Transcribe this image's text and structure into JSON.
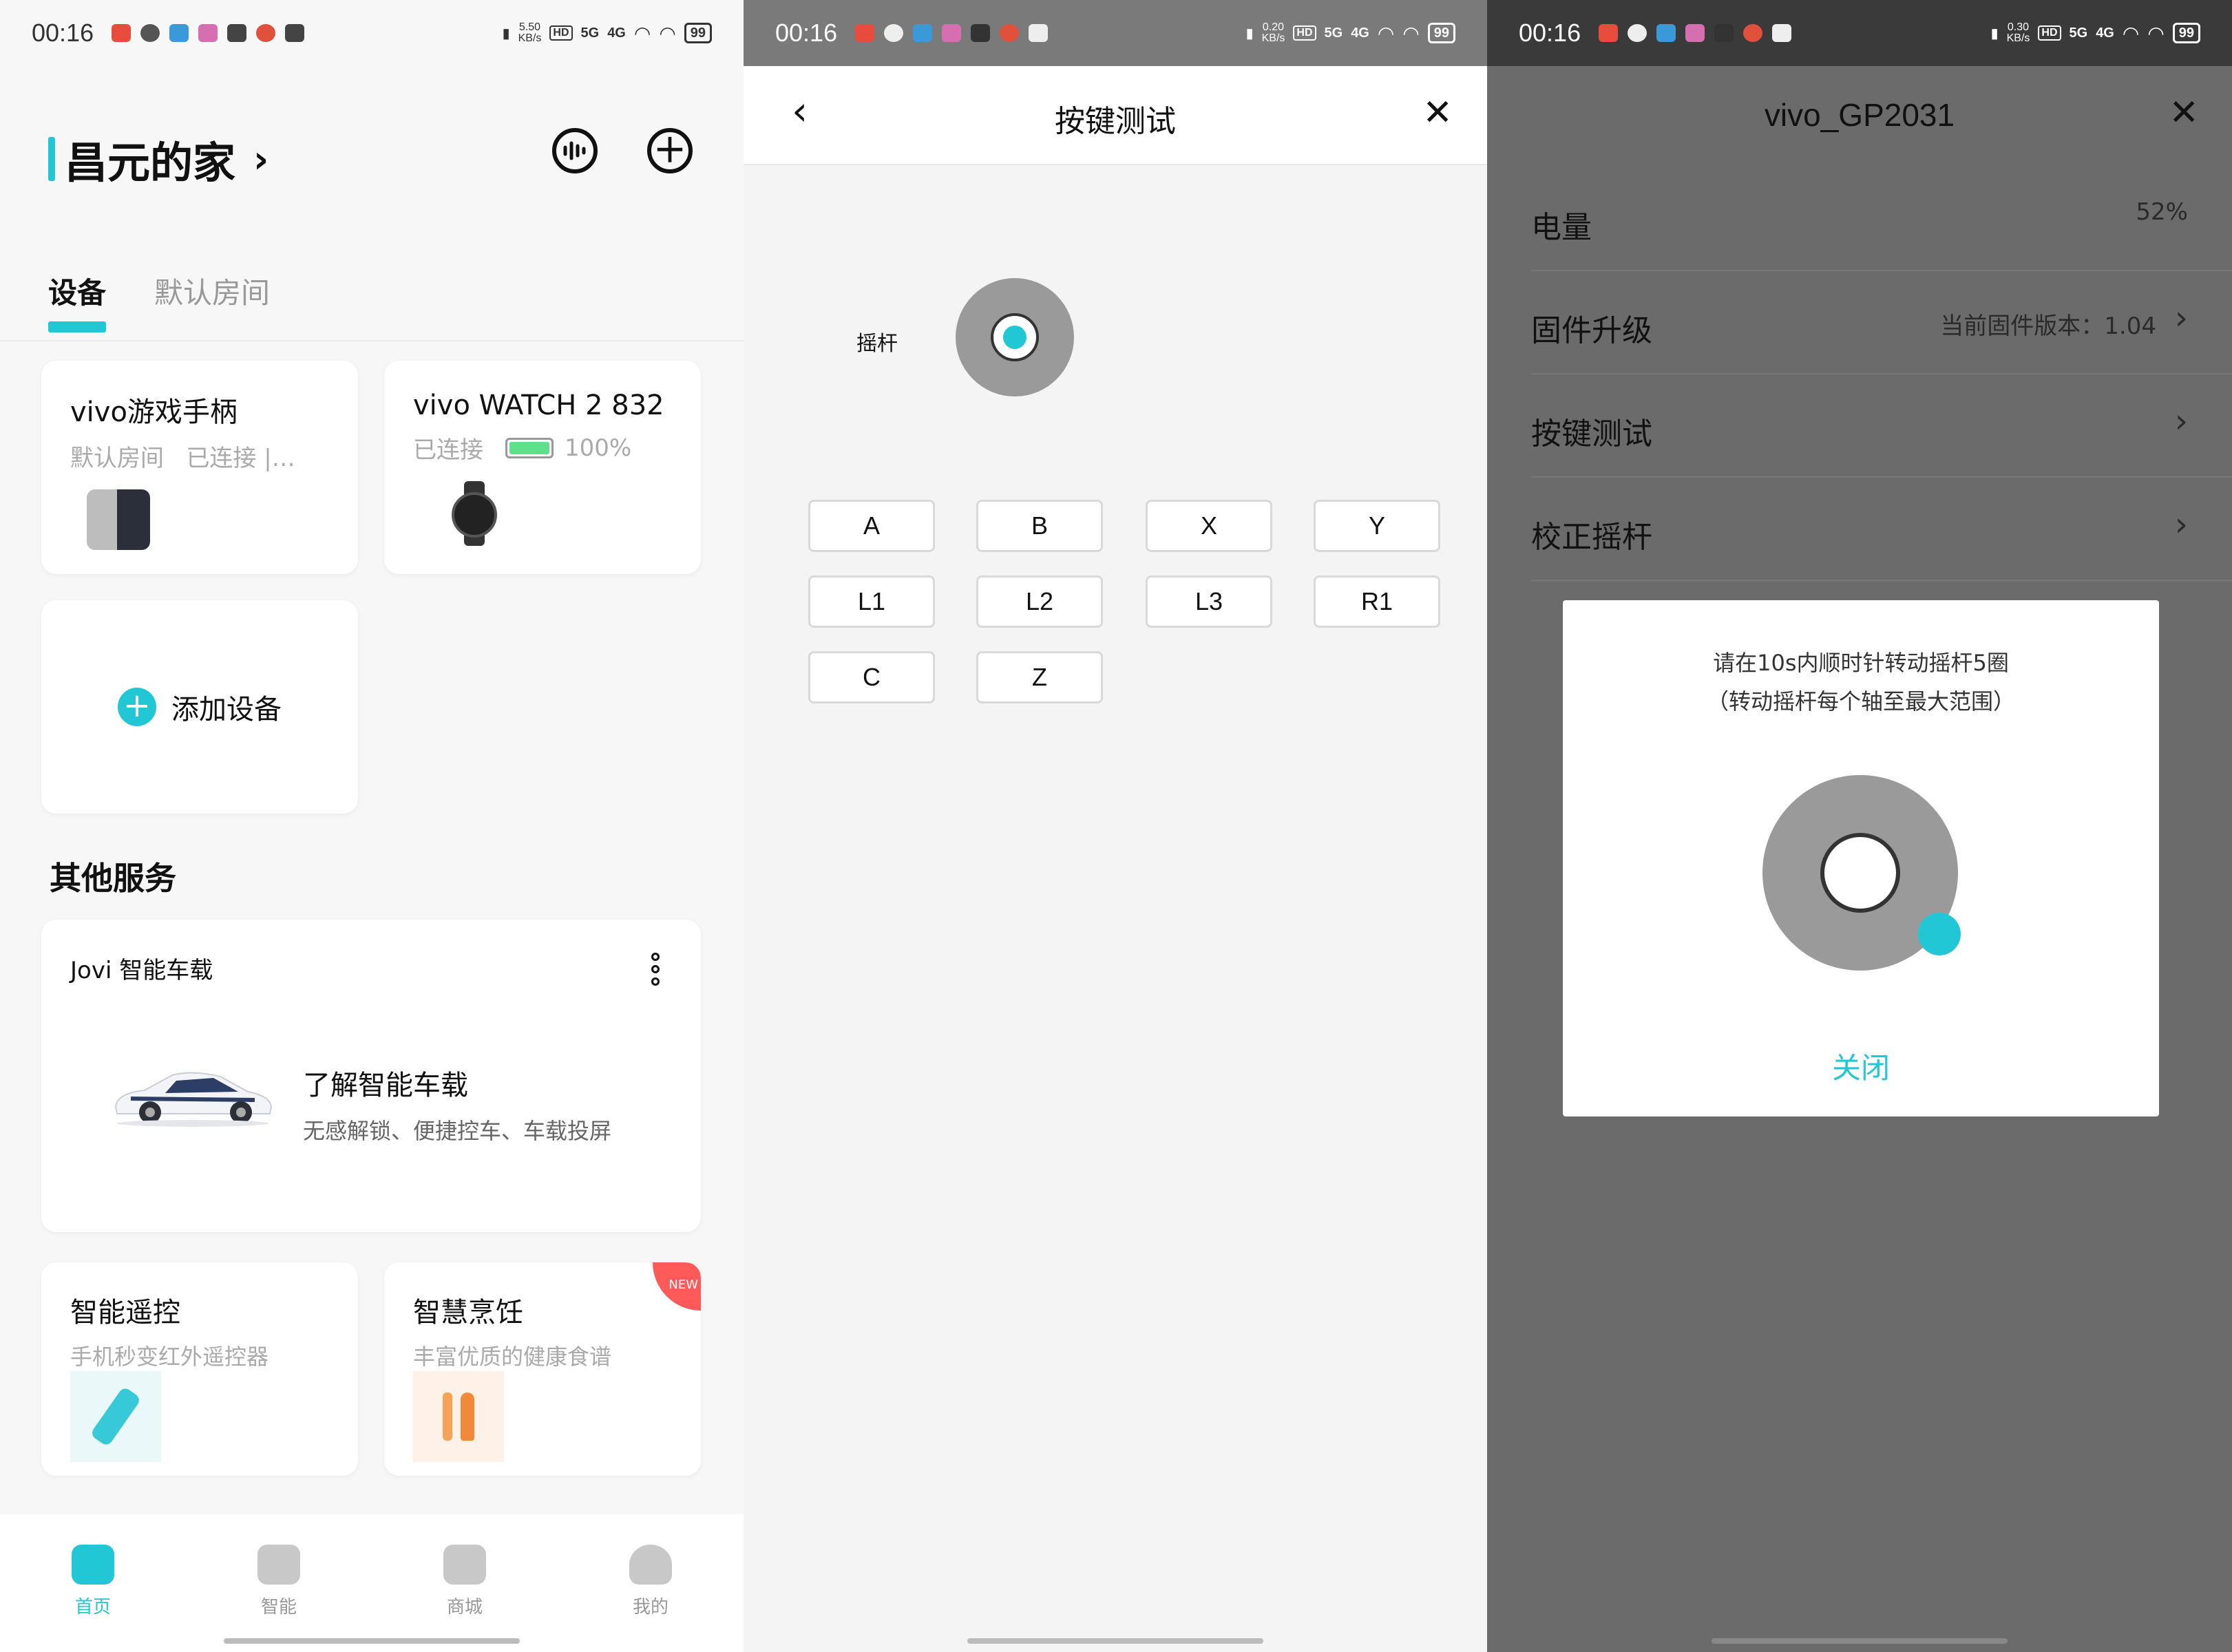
{
  "status_bars": [
    {
      "time": "00:16",
      "speed_value": "5.50",
      "speed_unit": "KB/s",
      "hd": "HD",
      "net1": "5G",
      "net2": "4G",
      "battery": "99"
    },
    {
      "time": "00:16",
      "speed_value": "0.20",
      "speed_unit": "KB/s",
      "hd": "HD",
      "net1": "5G",
      "net2": "4G",
      "battery": "99"
    },
    {
      "time": "00:16",
      "speed_value": "0.30",
      "speed_unit": "KB/s",
      "hd": "HD",
      "net1": "5G",
      "net2": "4G",
      "battery": "99"
    }
  ],
  "home": {
    "title": "昌元的家",
    "tabs": [
      "设备",
      "默认房间"
    ],
    "devices": [
      {
        "name": "vivo游戏手柄",
        "room": "默认房间",
        "status": "已连接 |…"
      },
      {
        "name": "vivo WATCH 2 832",
        "status": "已连接",
        "battery": "100%",
        "battery_level": 1.0
      }
    ],
    "add_device": "添加设备",
    "other_services": "其他服务",
    "jovi": {
      "label": "Jovi 智能车载",
      "headline": "了解智能车载",
      "desc": "无感解锁、便捷控车、车载投屏"
    },
    "remote": {
      "title": "智能遥控",
      "desc": "手机秒变红外遥控器"
    },
    "cooking": {
      "title": "智慧烹饪",
      "desc": "丰富优质的健康食谱",
      "badge": "NEW"
    },
    "nav": [
      "首页",
      "智能",
      "商城",
      "我的"
    ]
  },
  "key_test": {
    "title": "按键测试",
    "joystick_label": "摇杆",
    "keys": [
      "A",
      "B",
      "X",
      "Y",
      "L1",
      "L2",
      "L3",
      "R1",
      "C",
      "Z"
    ]
  },
  "device_detail": {
    "title": "vivo_GP2031",
    "rows": [
      {
        "label": "电量",
        "value": "52%"
      },
      {
        "label": "固件升级",
        "value": "当前固件版本：1.04"
      },
      {
        "label": "按键测试",
        "value": ""
      },
      {
        "label": "校正摇杆",
        "value": ""
      }
    ],
    "dialog": {
      "line1": "请在10s内顺时针转动摇杆5圈",
      "line2": "（转动摇杆每个轴至最大范围）",
      "close": "关闭"
    }
  },
  "colors": {
    "accent": "#22c7d6",
    "gray": "#9a9a9a",
    "badge": "#ff5a5a"
  }
}
